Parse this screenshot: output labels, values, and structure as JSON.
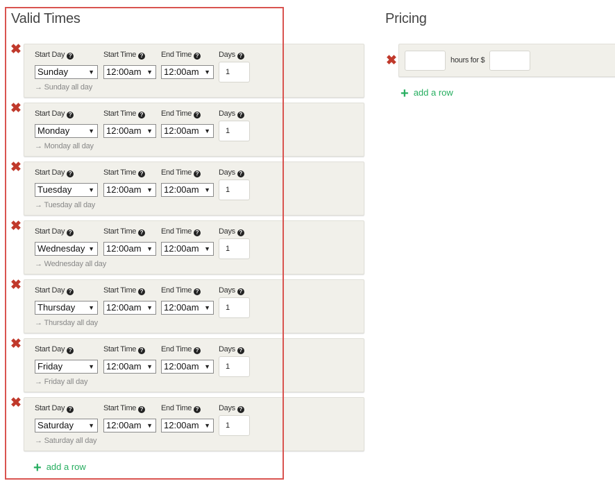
{
  "valid_times": {
    "title": "Valid Times",
    "labels": {
      "start_day": "Start Day",
      "start_time": "Start Time",
      "end_time": "End Time",
      "days": "Days"
    },
    "help_glyph": "?",
    "remove_glyph": "✖",
    "caret_glyph": "▼",
    "rows": [
      {
        "day": "Sunday",
        "start": "12:00am",
        "end": "12:00am",
        "days": "1",
        "summary": "→ Sunday all day"
      },
      {
        "day": "Monday",
        "start": "12:00am",
        "end": "12:00am",
        "days": "1",
        "summary": "→ Monday all day"
      },
      {
        "day": "Tuesday",
        "start": "12:00am",
        "end": "12:00am",
        "days": "1",
        "summary": "→ Tuesday all day"
      },
      {
        "day": "Wednesday",
        "start": "12:00am",
        "end": "12:00am",
        "days": "1",
        "summary": "→ Wednesday all day"
      },
      {
        "day": "Thursday",
        "start": "12:00am",
        "end": "12:00am",
        "days": "1",
        "summary": "→ Thursday all day"
      },
      {
        "day": "Friday",
        "start": "12:00am",
        "end": "12:00am",
        "days": "1",
        "summary": "→ Friday all day"
      },
      {
        "day": "Saturday",
        "start": "12:00am",
        "end": "12:00am",
        "days": "1",
        "summary": "→ Saturday all day"
      }
    ],
    "add_row": {
      "glyph": "+",
      "label": "add a row"
    }
  },
  "pricing": {
    "title": "Pricing",
    "remove_glyph": "✖",
    "hours_value": "",
    "hours_for_text": "hours for $",
    "price_value": "",
    "add_row": {
      "glyph": "+",
      "label": "add a row"
    }
  },
  "colors": {
    "highlight": "#d9534f",
    "remove": "#c0392b",
    "add": "#27ae60",
    "card_bg": "#f1f0ea"
  }
}
